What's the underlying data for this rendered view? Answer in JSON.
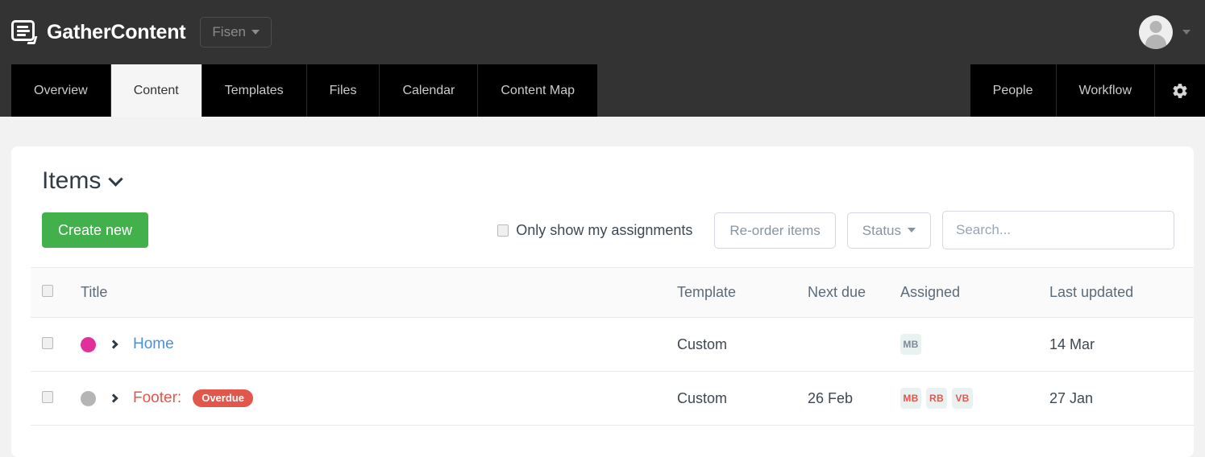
{
  "topbar": {
    "brand_name": "GatherContent",
    "logo_icon": "gathercontent-logo-icon",
    "project_name": "Fisen",
    "project_caret_icon": "caret-down-icon",
    "avatar_icon": "user-avatar-icon",
    "avatar_caret_icon": "caret-down-icon"
  },
  "nav": {
    "left_tabs": [
      {
        "label": "Overview",
        "active": false
      },
      {
        "label": "Content",
        "active": true
      },
      {
        "label": "Templates",
        "active": false
      },
      {
        "label": "Files",
        "active": false
      },
      {
        "label": "Calendar",
        "active": false
      },
      {
        "label": "Content Map",
        "active": false
      }
    ],
    "right_tabs": [
      {
        "label": "People"
      },
      {
        "label": "Workflow"
      }
    ],
    "settings_icon": "gear-icon"
  },
  "page": {
    "title": "Items",
    "title_caret_icon": "chevron-down-icon"
  },
  "toolbar": {
    "create_label": "Create new",
    "assignments_filter_label": "Only show my assignments",
    "assignments_filter_checked": false,
    "reorder_label": "Re-order items",
    "status_label": "Status",
    "status_caret_icon": "caret-down-icon",
    "search_placeholder": "Search...",
    "search_value": ""
  },
  "table": {
    "select_all_checked": false,
    "columns": {
      "title": "Title",
      "template": "Template",
      "next_due": "Next due",
      "assigned": "Assigned",
      "last_updated": "Last updated"
    },
    "rows": [
      {
        "checked": false,
        "status_color": "#e0309a",
        "expand_icon": "chevron-right-icon",
        "title": "Home",
        "overdue": false,
        "badge": "",
        "template": "Custom",
        "next_due": "",
        "assigned": [
          "MB"
        ],
        "last_updated": "14 Mar"
      },
      {
        "checked": false,
        "status_color": "#b5b5b5",
        "expand_icon": "chevron-right-icon",
        "title": "Footer:",
        "overdue": true,
        "badge": "Overdue",
        "template": "Custom",
        "next_due": "26 Feb",
        "assigned": [
          "MB",
          "RB",
          "VB"
        ],
        "last_updated": "27 Jan"
      }
    ]
  },
  "colors": {
    "brand_dark": "#333333",
    "nav_black": "#000000",
    "accent_green": "#43b14b",
    "link_blue": "#4a90e2",
    "danger_red": "#e2574c",
    "page_bg": "#f2f2f2"
  }
}
